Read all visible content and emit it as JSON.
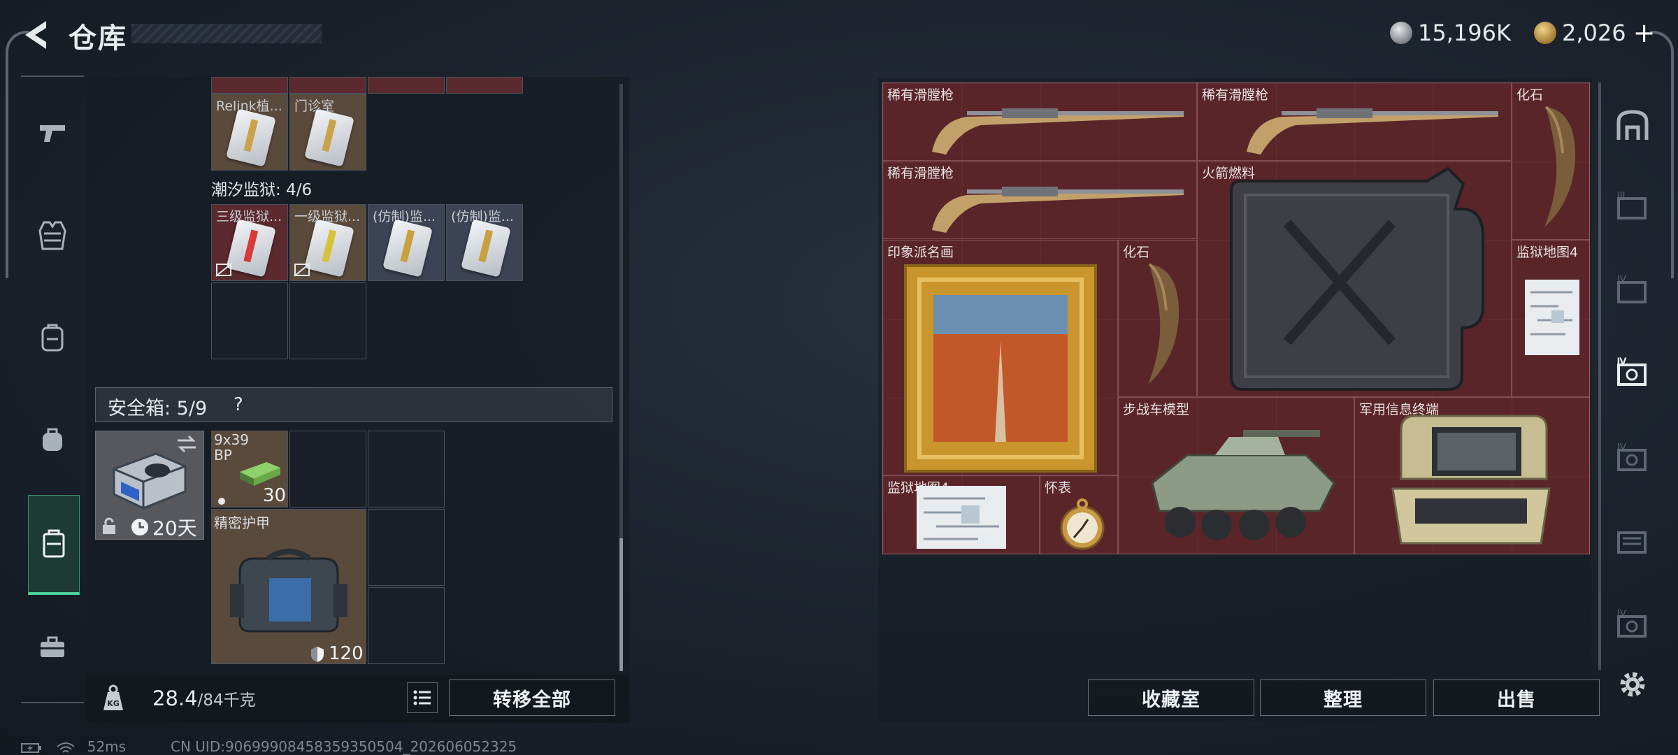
{
  "header": {
    "title": "仓库",
    "currency_silver": "15,196K",
    "currency_gold": "2,026",
    "plus_label": "+"
  },
  "left_nav": {
    "items": [
      "pistol-icon",
      "vest-icon",
      "backpack-icon",
      "bag-icon",
      "container-icon",
      "toolbox-icon"
    ],
    "active_index": 4
  },
  "container": {
    "row1_labels": [
      "Relink植...",
      "门诊室"
    ],
    "section_title": "潮汐监狱: 4/6",
    "row2_labels": [
      "三级监狱...",
      "一级监狱...",
      "(仿制)监...",
      "(仿制)监..."
    ]
  },
  "safe_box": {
    "label": "安全箱: 5/9",
    "help": "?",
    "days": "20天",
    "ammo_label_line1": "9x39",
    "ammo_label_line2": "BP",
    "ammo_count": "30",
    "armor_label": "精密护甲",
    "armor_value": "120"
  },
  "footer_left": {
    "weight_current": "28.4",
    "weight_max": "/84千克",
    "transfer_all": "转移全部"
  },
  "stash": {
    "items": [
      {
        "label": "稀有滑膛枪"
      },
      {
        "label": "稀有滑膛枪"
      },
      {
        "label": "化石"
      },
      {
        "label": "稀有滑膛枪"
      },
      {
        "label": "火箭燃料"
      },
      {
        "label": "印象派名画"
      },
      {
        "label": "化石"
      },
      {
        "label": "监狱地图4"
      },
      {
        "label": "步战车模型"
      },
      {
        "label": "军用信息终端"
      },
      {
        "label": "监狱地图4"
      },
      {
        "label": "怀表"
      }
    ]
  },
  "footer_right": {
    "collection": "收藏室",
    "organize": "整理",
    "sell": "出售"
  },
  "status_bar": {
    "ping": "52ms",
    "uid": "CN UID:9069990845835935050​4_202606052325"
  },
  "colors": {
    "stash_bg": "#5a2529",
    "active_nav": "#4bd19a"
  }
}
